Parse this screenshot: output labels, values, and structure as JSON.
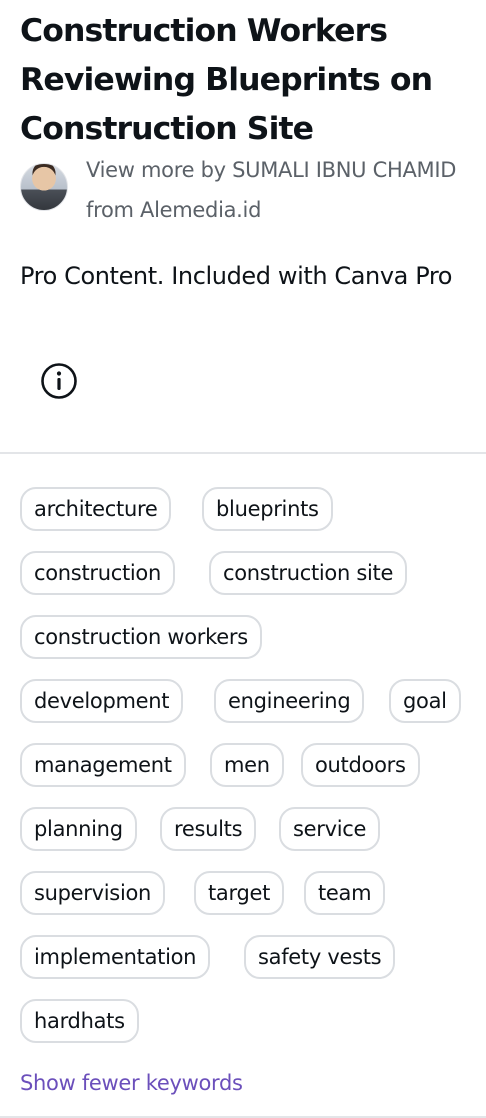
{
  "asset": {
    "title": "Construction Workers Reviewing Blueprints on Construction Site",
    "author_text": "View more by SUMALI IBNU CHAMID from Alemedia.id",
    "pro_text": "Pro Content. Included with Canva Pro",
    "info_icon": "info-circle-icon"
  },
  "keywords": [
    "architecture",
    "blueprints",
    "construction",
    "construction site",
    "construction workers",
    "development",
    "engineering",
    "goal",
    "management",
    "men",
    "outdoors",
    "planning",
    "results",
    "service",
    "supervision",
    "target",
    "team",
    "implementation",
    "safety vests",
    "hardhats"
  ],
  "show_fewer_label": "Show fewer keywords",
  "colors": {
    "text": "#0e1318",
    "muted": "#5b6168",
    "link": "#6b4fbb",
    "chip_border": "#dadde1"
  }
}
